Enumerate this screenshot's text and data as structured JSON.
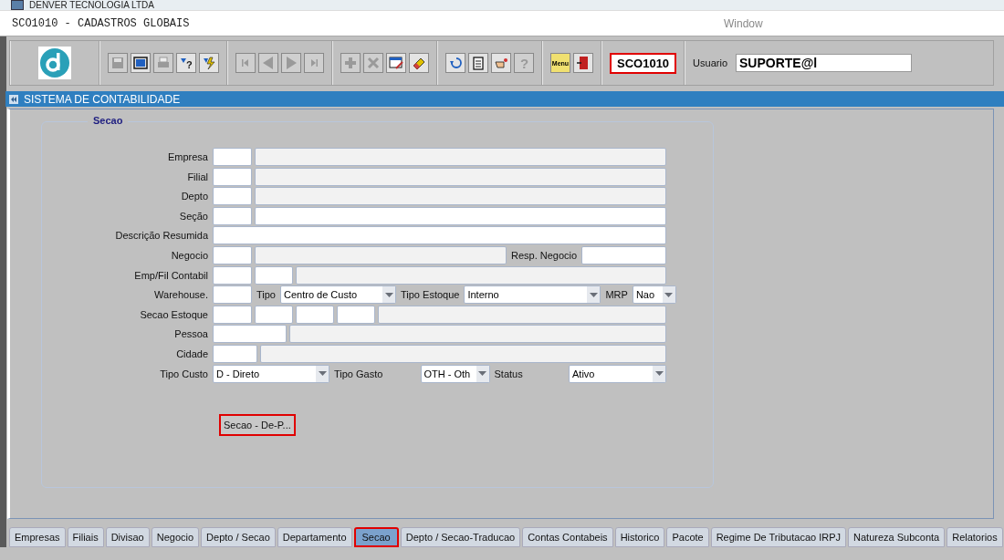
{
  "app_title": "DENVER TECNOLOGIA LTDA",
  "window": {
    "title": "SCO1010 - CADASTROS GLOBAIS",
    "menu": "Window"
  },
  "toolbar": {
    "groups": [
      [
        {
          "kind": "save",
          "disabled": true
        },
        {
          "kind": "window",
          "disabled": false
        },
        {
          "kind": "print",
          "disabled": true
        },
        {
          "kind": "query",
          "disabled": false,
          "glyph": "?"
        },
        {
          "kind": "execute",
          "disabled": false
        }
      ],
      [
        {
          "kind": "first",
          "disabled": true
        },
        {
          "kind": "prev",
          "disabled": true
        },
        {
          "kind": "next",
          "disabled": true
        },
        {
          "kind": "last",
          "disabled": true
        }
      ],
      [
        {
          "kind": "add",
          "disabled": true
        },
        {
          "kind": "delete",
          "disabled": true
        },
        {
          "kind": "edit",
          "disabled": false
        },
        {
          "kind": "erase",
          "disabled": false
        }
      ],
      [
        {
          "kind": "undo",
          "disabled": false
        },
        {
          "kind": "clipboard",
          "disabled": false
        },
        {
          "kind": "hand",
          "disabled": false
        },
        {
          "kind": "help",
          "disabled": true,
          "glyph": "?"
        }
      ],
      [
        {
          "kind": "menu",
          "disabled": false,
          "text": "Menu"
        },
        {
          "kind": "exit",
          "disabled": false
        }
      ]
    ],
    "form_code": "SCO1010",
    "user_label": "Usuario",
    "user_value": "SUPORTE@l"
  },
  "section_bar": "SISTEMA DE CONTABILIDADE",
  "fieldset": {
    "legend": "Secao",
    "rows": [
      {
        "label": "Empresa",
        "fields": [
          {
            "kind": "input"
          },
          {
            "kind": "readonly"
          }
        ]
      },
      {
        "label": "Filial",
        "fields": [
          {
            "kind": "input"
          },
          {
            "kind": "readonly"
          }
        ]
      },
      {
        "label": "Depto",
        "fields": [
          {
            "kind": "input"
          },
          {
            "kind": "readonly"
          }
        ]
      },
      {
        "label": "Seção",
        "fields": [
          {
            "kind": "input"
          },
          {
            "kind": "input"
          }
        ]
      },
      {
        "label": "Descrição Resumida",
        "fields": [
          {
            "kind": "input"
          }
        ]
      },
      {
        "label": "Negocio",
        "fields": [
          {
            "kind": "input"
          },
          {
            "kind": "readonly"
          },
          {
            "kind": "label",
            "text": "Resp. Negocio"
          },
          {
            "kind": "input"
          }
        ]
      },
      {
        "label": "Emp/Fil Contabil",
        "fields": [
          {
            "kind": "input"
          },
          {
            "kind": "input"
          },
          {
            "kind": "readonly"
          }
        ]
      },
      {
        "label": "Warehouse.",
        "fields": [
          {
            "kind": "input"
          },
          {
            "kind": "label",
            "text": "Tipo"
          },
          {
            "kind": "select",
            "value": "Centro de Custo"
          },
          {
            "kind": "label",
            "text": "Tipo Estoque"
          },
          {
            "kind": "select",
            "value": "Interno"
          },
          {
            "kind": "label",
            "text": "MRP"
          },
          {
            "kind": "select",
            "value": "Nao"
          }
        ]
      },
      {
        "label": "Secao Estoque",
        "fields": [
          {
            "kind": "input"
          },
          {
            "kind": "input"
          },
          {
            "kind": "input"
          },
          {
            "kind": "input"
          },
          {
            "kind": "readonly"
          }
        ]
      },
      {
        "label": "Pessoa",
        "fields": [
          {
            "kind": "input"
          },
          {
            "kind": "readonly"
          }
        ]
      },
      {
        "label": "Cidade",
        "fields": [
          {
            "kind": "input"
          },
          {
            "kind": "readonly"
          }
        ]
      },
      {
        "label": "Tipo Custo",
        "fields": [
          {
            "kind": "select",
            "value": "D - Direto"
          },
          {
            "kind": "label",
            "text": "Tipo Gasto"
          },
          {
            "kind": "select",
            "value": "OTH - Oth"
          },
          {
            "kind": "label",
            "text": "Status"
          },
          {
            "kind": "select",
            "value": "Ativo"
          }
        ]
      }
    ],
    "button": "Secao - De-P..."
  },
  "tabs": [
    {
      "label": "Empresas",
      "selected": false
    },
    {
      "label": "Filiais",
      "selected": false
    },
    {
      "label": "Divisao",
      "selected": false
    },
    {
      "label": "Negocio",
      "selected": false
    },
    {
      "label": "Depto / Secao",
      "selected": false
    },
    {
      "label": "Departamento",
      "selected": false
    },
    {
      "label": "Secao",
      "selected": true
    },
    {
      "label": "Depto / Secao-Traducao",
      "selected": false
    },
    {
      "label": "Contas Contabeis",
      "selected": false
    },
    {
      "label": "Historico",
      "selected": false
    },
    {
      "label": "Pacote",
      "selected": false
    },
    {
      "label": "Regime De Tributacao IRPJ",
      "selected": false
    },
    {
      "label": "Natureza Subconta",
      "selected": false
    },
    {
      "label": "Relatorios",
      "selected": false
    }
  ]
}
